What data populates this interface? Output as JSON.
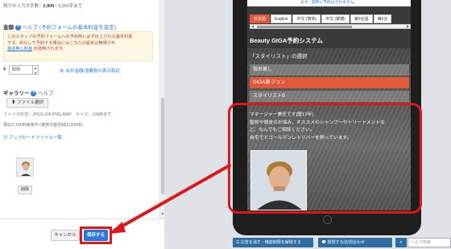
{
  "left_panel": {
    "char_count_prefix": "残りの入力文字数：",
    "char_count_value": "2,905",
    "char_count_suffix": " / 3,000字まで",
    "fee_label": "金額",
    "fee_help": "ヘルプ (予約フォームの基本料金を設定)",
    "notice_line1": "このスタッフの予約フォームへの予約時に必ず計上される基本料金",
    "notice_line2": "です。尚なしで予約する場合にはこちらの設定は無視され",
    "notice_link": "指名無し料金",
    "notice_line3": "が適用されます。",
    "yen": "¥",
    "price_value": "500",
    "total_link": "合計金額/消費税の表示設定",
    "gallery_label": "ギャラリー",
    "gallery_help": "ヘルプ",
    "file_select": "ファイル選択",
    "file_info": "ファイル形式：JPEG,GIF,PNG,BMP　サイズ：10MBまで",
    "file_capacity": "現在0.15MB使用中 (使用可能領域1120MB)",
    "uploaded_list": "アップロードファイル一覧",
    "delete_label": "削除",
    "cancel_label": "キャンセル",
    "save_label": "保存する"
  },
  "preview": {
    "top_strip": "ます。実際に予約はされません。",
    "languages": [
      "日本語",
      "English",
      "中文 (简体)",
      "中文 (繁體)",
      "第5言語",
      "第6言"
    ],
    "system_title": "Beauty GIGA予約システム",
    "section_title": "「スタイリスト」の選択",
    "options": [
      "指名無し",
      "GIGA瀬 ジュン",
      "スタイリストB"
    ],
    "description_lines": [
      "マネージャー兼任です[歴12年]",
      "髪質や頭皮のお悩み、オススメのシャンプーやトリートメントな",
      "ど、なんでもご相談ください。",
      "自宅でドゴールデンレトリバーを飼っています。"
    ]
  },
  "bottom_bar": {
    "ad_button": "広告を消す・機能制限を解除する",
    "contact_button": "質問する/お問合わせ",
    "search_placeholder": "ヘルプ検索"
  },
  "colors": {
    "accent_blue": "#2a7ae2",
    "highlight_red": "#e0161b",
    "active_orange": "#e05a3a"
  }
}
